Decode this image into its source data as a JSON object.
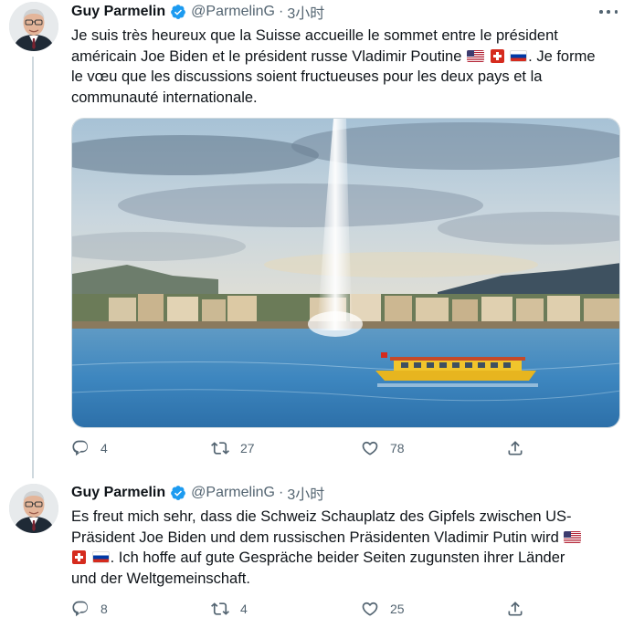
{
  "tweets": [
    {
      "author": {
        "name": "Guy Parmelin",
        "handle": "@ParmelinG",
        "verified": true
      },
      "separator": "·",
      "time": "3小时",
      "text_lines": [
        [
          "Je suis très heureux que la Suisse accueille le sommet entre le président"
        ],
        [
          "américain Joe Biden et le président russe Vladimir Poutine",
          ". Je forme"
        ],
        [
          "le vœu que les discussions soient fructueuses pour les deux pays et la"
        ],
        [
          "communauté internationale."
        ]
      ],
      "flags": [
        "us-flag",
        "swiss-flag",
        "russia-flag"
      ],
      "media": {
        "description_icon": "photo"
      },
      "stats": {
        "replies": "4",
        "retweets": "27",
        "likes": "78"
      }
    },
    {
      "author": {
        "name": "Guy Parmelin",
        "handle": "@ParmelinG",
        "verified": true
      },
      "separator": "·",
      "time": "3小时",
      "text_lines": [
        [
          "Es freut mich sehr, dass die Schweiz Schauplatz des Gipfels zwischen US-"
        ],
        [
          "Präsident Joe Biden und dem russischen Präsidenten Vladimir Putin wird"
        ],
        [
          ". Ich hoffe auf gute Gespräche beider Seiten zugunsten ihrer Länder"
        ],
        [
          "und der Weltgemeinschaft."
        ]
      ],
      "flags": [
        "us-flag",
        "swiss-flag",
        "russia-flag"
      ],
      "stats": {
        "replies": "8",
        "retweets": "4",
        "likes": "25"
      }
    }
  ],
  "colors": {
    "text": "#0f1419",
    "secondary": "#536471",
    "verified": "#1d9bf0",
    "thread_line": "#cfd9de"
  }
}
